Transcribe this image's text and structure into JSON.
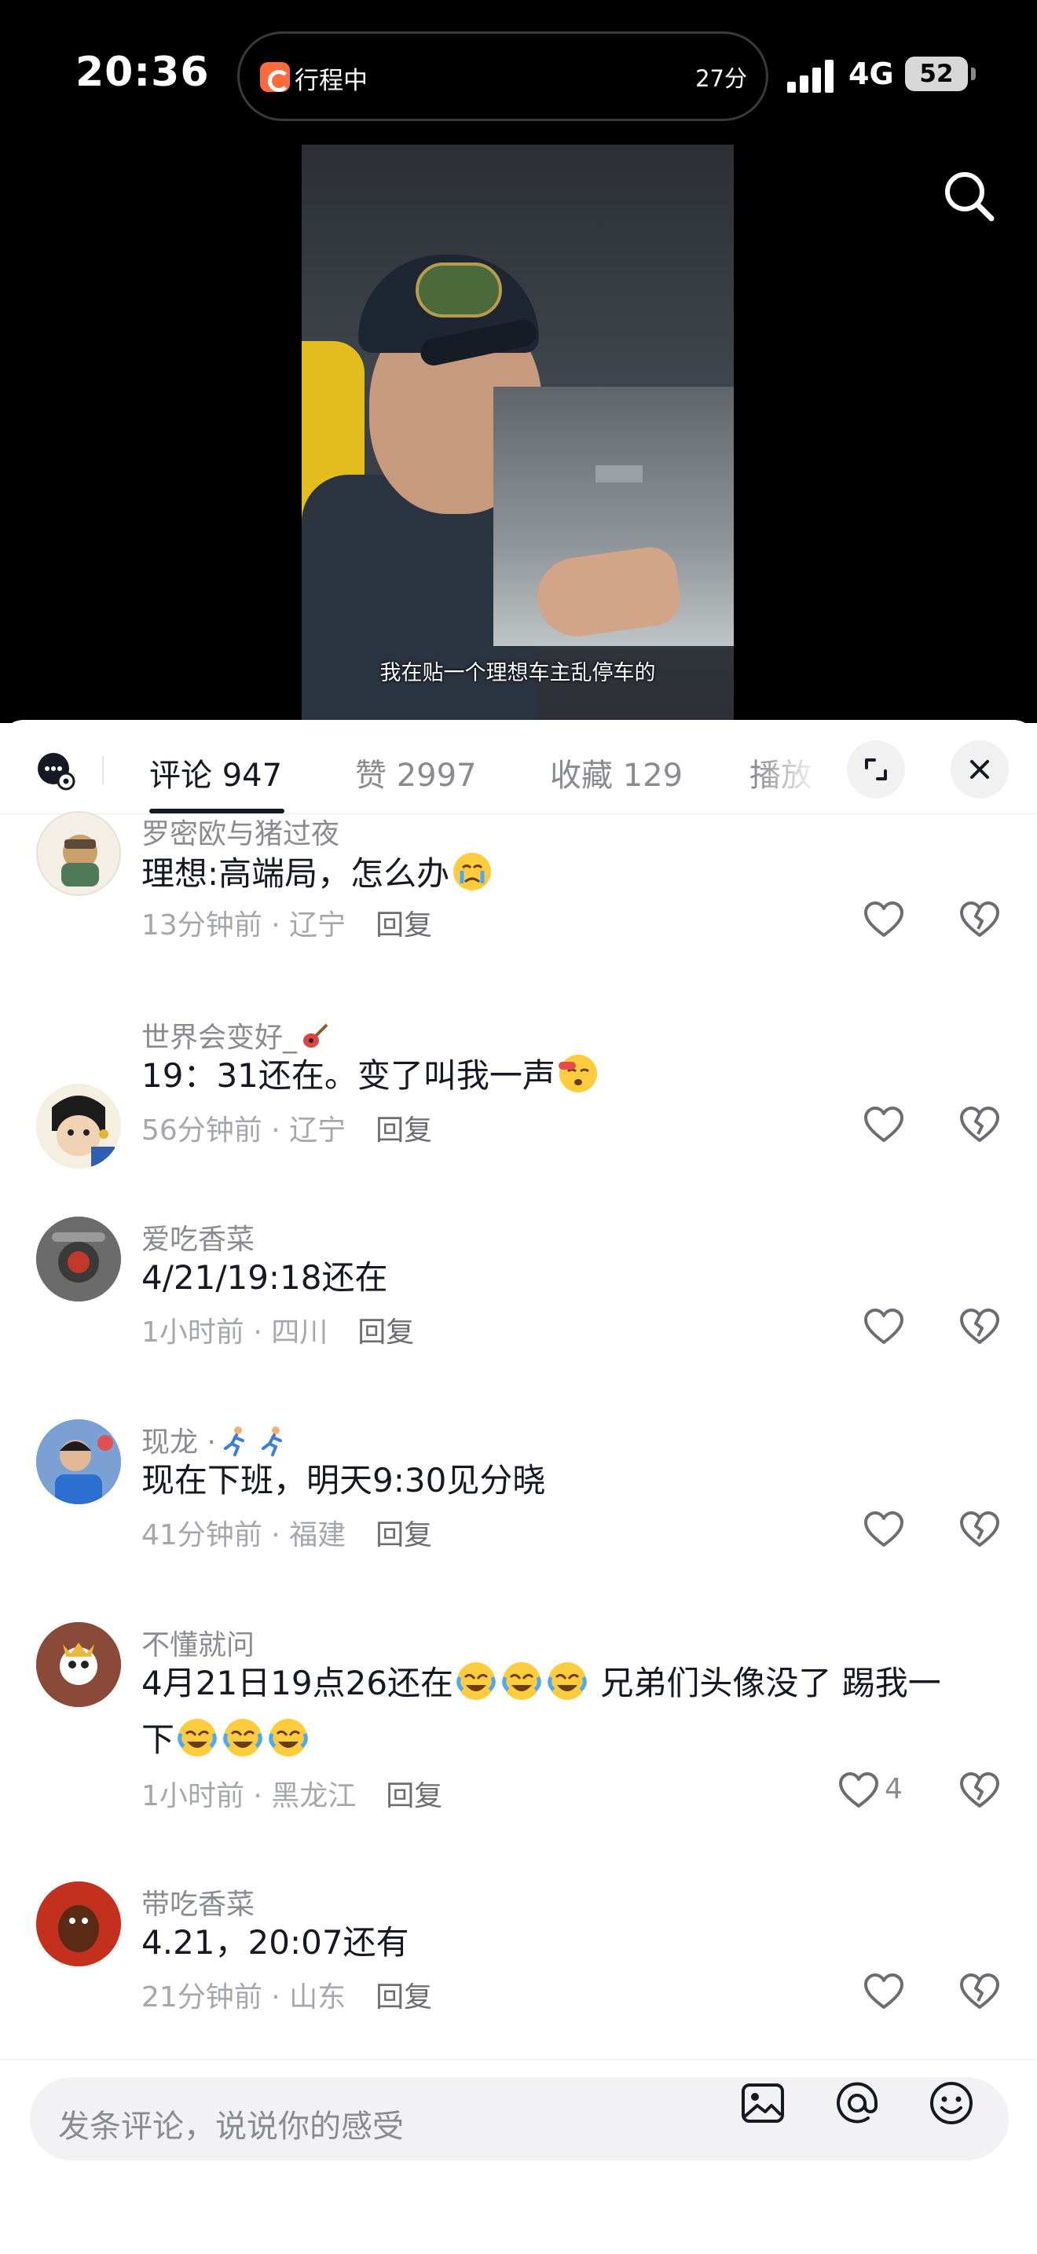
{
  "status_bar": {
    "time": "20:36",
    "activity_label": "行程中",
    "activity_time": "27分",
    "network": "4G",
    "battery": "52"
  },
  "video": {
    "subtitle": "我在贴一个理想车主乱停车的"
  },
  "tabs": [
    {
      "label": "评论 947",
      "active": true
    },
    {
      "label": "赞 2997",
      "active": false
    },
    {
      "label": "收藏 129",
      "active": false
    },
    {
      "label": "播放",
      "active": false
    }
  ],
  "comments": [
    {
      "user": "罗密欧与猪过夜",
      "text": "理想:高端局，怎么办",
      "time": "13分钟前",
      "location": "辽宁",
      "reply": "回复",
      "emoji": "cry-face"
    },
    {
      "user": "世界会变好_",
      "user_emoji": "guitar",
      "text": "19：31还在。变了叫我一声",
      "time": "56分钟前",
      "location": "辽宁",
      "reply": "回复",
      "emoji": "whistle-face"
    },
    {
      "user": "爱吃香菜",
      "text": "4/21/19:18还在",
      "time": "1小时前",
      "location": "四川",
      "reply": "回复"
    },
    {
      "user": "现龙 ·",
      "user_emoji": "runner",
      "text": "现在下班，明天9:30见分晓",
      "time": "41分钟前",
      "location": "福建",
      "reply": "回复"
    },
    {
      "user": "不懂就问",
      "text_line1": "4月21日19点26还在",
      "text_line1_tail": " 兄弟们头像没了 踢我一",
      "text_line2": "下",
      "time": "1小时前",
      "location": "黑龙江",
      "reply": "回复",
      "likes": "4",
      "emoji": "laugh-cry-face"
    },
    {
      "user": "带吃香菜",
      "text": "4.21，20:07还有",
      "time": "21分钟前",
      "location": "山东",
      "reply": "回复"
    }
  ],
  "input": {
    "placeholder": "发条评论，说说你的感受"
  },
  "meta_separator": " · "
}
